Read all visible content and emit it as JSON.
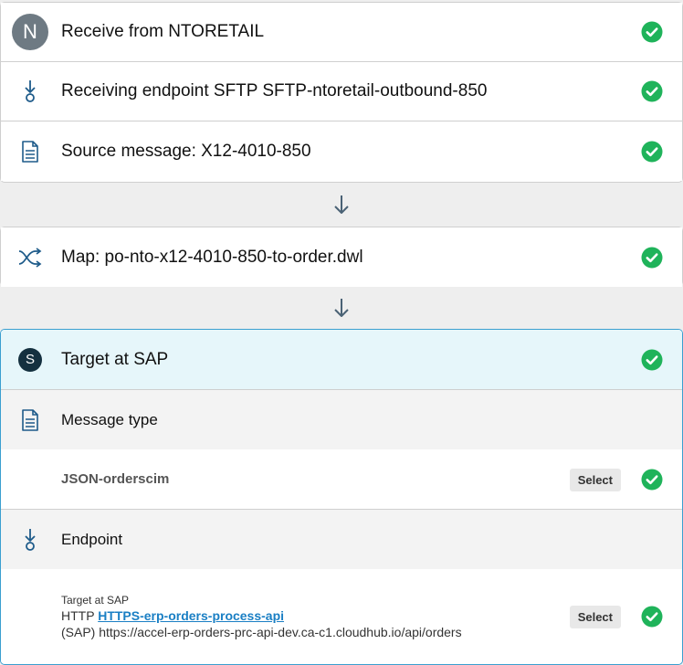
{
  "source_card": {
    "receive": {
      "avatar_letter": "N",
      "title": "Receive from NTORETAIL"
    },
    "endpoint": {
      "title": "Receiving endpoint SFTP SFTP-ntoretail-outbound-850"
    },
    "message": {
      "title": "Source message: X12-4010-850"
    }
  },
  "map_card": {
    "title": "Map: po-nto-x12-4010-850-to-order.dwl"
  },
  "target_card": {
    "avatar_letter": "S",
    "title": "Target at SAP",
    "message_type": {
      "section_title": "Message type",
      "value": "JSON-orderscim",
      "select_label": "Select"
    },
    "endpoint": {
      "section_title": "Endpoint",
      "target_label": "Target at SAP",
      "protocol": "HTTP",
      "link_text": "HTTPS-erp-orders-process-api",
      "url": "(SAP) https://accel-erp-orders-prc-api-dev.ca-c1.cloudhub.io/api/orders",
      "select_label": "Select"
    }
  },
  "colors": {
    "check_green": "#1fb35a",
    "accent_blue": "#3b9fd0",
    "icon_blue": "#1e5b8a",
    "arrow_gray": "#4a6275"
  }
}
